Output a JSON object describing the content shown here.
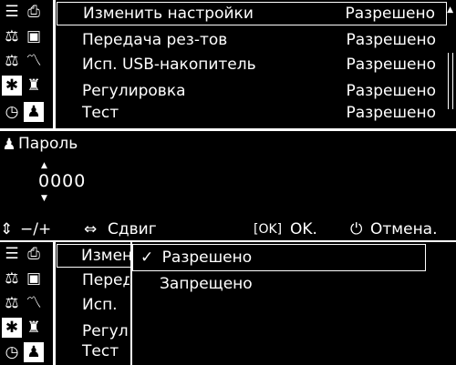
{
  "settings_list": {
    "items": [
      {
        "label": "Изменить настройки",
        "value": "Разрешено"
      },
      {
        "label": "Передача рез-тов",
        "value": "Разрешено"
      },
      {
        "label": "Исп. USB-накопитель",
        "value": "Разрешено"
      },
      {
        "label": "Регулировка",
        "value": "Разрешено"
      },
      {
        "label": "Тест",
        "value": "Разрешено"
      }
    ]
  },
  "password": {
    "title": "Пароль",
    "value": "0000"
  },
  "bottom_bar": {
    "adjust_label": "−/+",
    "shift_label": "Сдвиг",
    "ok_key": "[OK]",
    "ok_label": "OK.",
    "cancel_label": "Отмена."
  },
  "dropdown": {
    "check_mark": "✓",
    "options": [
      "Разрешено",
      "Запрещено"
    ],
    "selected": "Разрешено"
  },
  "clipped_labels": [
    "Измен",
    "Перед",
    "Исп.",
    "Регул",
    "Тест"
  ],
  "icons": [
    "menu-icon",
    "print-icon",
    "balance-icon",
    "save-icon",
    "balance-settings-icon",
    "chart-icon",
    "gear-icon",
    "weight-icon",
    "timer-icon",
    "user-icon"
  ]
}
